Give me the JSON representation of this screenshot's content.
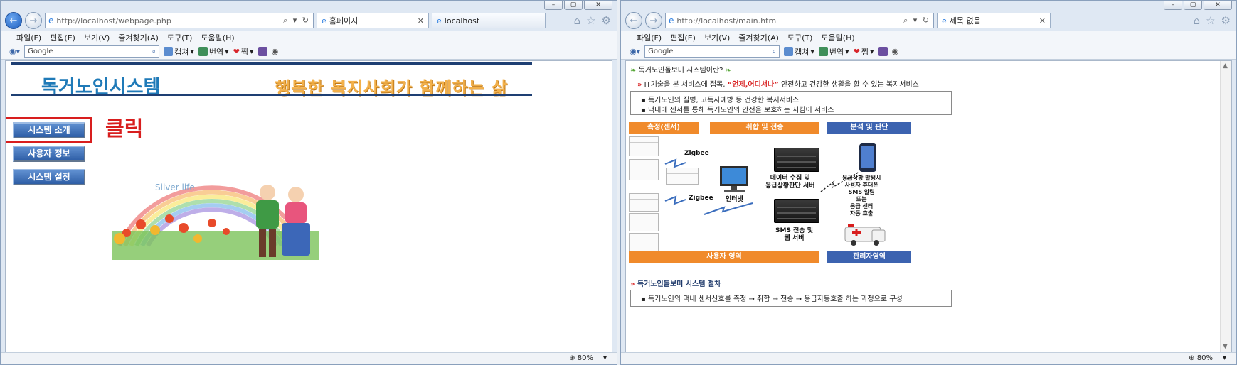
{
  "left_window": {
    "address": {
      "host": "http://localhost",
      "path": "/webpage.php"
    },
    "tabs": [
      {
        "label": "홈페이지",
        "active": true
      },
      {
        "label": "localhost",
        "active": false
      }
    ],
    "menu": [
      "파일(F)",
      "편집(E)",
      "보기(V)",
      "즐겨찾기(A)",
      "도구(T)",
      "도움말(H)"
    ],
    "toolbar": {
      "search_placeholder": "Google",
      "capture": "캡쳐",
      "translate": "번역",
      "jjim": "찜"
    },
    "page": {
      "title": "독거노인시스템",
      "slogan": "행복한 복지사회가 함께하는 삶",
      "buttons": [
        "시스템 소개",
        "사용자 정보",
        "시스템 설정"
      ],
      "click_note": "클릭",
      "image_caption": "Silver life"
    },
    "status": {
      "zoom": "80%"
    }
  },
  "right_window": {
    "address": {
      "host": "http://localhost",
      "path": "/main.htm"
    },
    "tabs": [
      {
        "label": "제목 없음",
        "active": true
      }
    ],
    "menu": [
      "파일(F)",
      "편집(E)",
      "보기(V)",
      "즐겨찾기(A)",
      "도구(T)",
      "도움말(H)"
    ],
    "toolbar": {
      "search_placeholder": "Google",
      "capture": "캡쳐",
      "translate": "번역",
      "jjim": "찜"
    },
    "page": {
      "section1_title": "독거노인돌보미 시스템이란?",
      "intro_prefix": "IT기술을 본 서비스에 접목,",
      "intro_highlight": "“언제,어디서나”",
      "intro_suffix": "안전하고 건강한 생활을 할 수 있는 복지서비스",
      "bullets": [
        "독거노인의 질병, 고독사예방 등 건강한 복지서비스",
        "댁내에 센서를 통해 독거노인의 안전을 보호하는 지킴이 서비스"
      ],
      "diagram": {
        "bar_sensing": "측정(센서)",
        "bar_collect": "취합 및 전송",
        "bar_analysis": "분석 및 판단",
        "zigbee": "Zigbee",
        "internet": "인터넷",
        "server1": "데이터 수집 및\n응급상황판단 서버",
        "server2": "SMS 전송 및\n웹 서버",
        "alert": "응급상황 발생시\n사용자 휴대폰\nSMS 알림\n또는\n응급 센터\n자동 호출",
        "bar_user": "사용자 영역",
        "bar_admin": "관리자영역"
      },
      "section2_title": "독거노인돌보미 시스템 절차",
      "procedure": "독거노인의 댁내 센서신호를 측정 → 취합 → 전송 → 응급자동호출 하는 과정으로 구성"
    },
    "status": {
      "zoom": "80%"
    }
  },
  "colors": {
    "title_blue": "#1f7ab8",
    "slogan_orange": "#f2b04a",
    "button_blue": "#2e5ea6",
    "highlight_red": "#d81e1e",
    "bar_orange": "#f08a2b",
    "bar_blue": "#3c63b0"
  }
}
